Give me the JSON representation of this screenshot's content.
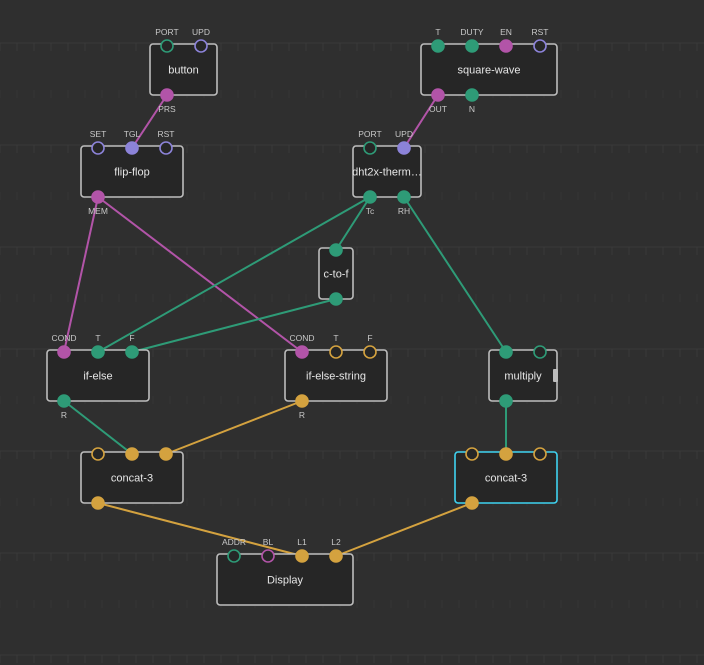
{
  "colors": {
    "background": "#2f2f2f",
    "grid": "#3a3a3a",
    "node_fill": "#262626",
    "node_border": "#bdbdbd",
    "selected_border": "#3fd3f1",
    "selected_label": "#3fd3f1",
    "pulse": "#8c83d9",
    "boolean": "#b254a8",
    "number": "#2e9b77",
    "string": "#d4a23f",
    "port": "#2e9b77"
  },
  "nodes": [
    {
      "id": "button",
      "label": "button",
      "selected": false,
      "inputs": [
        {
          "label": "PORT",
          "type": "port"
        },
        {
          "label": "UPD",
          "type": "pulse"
        }
      ],
      "outputs": [
        {
          "label": "PRS",
          "type": "boolean"
        }
      ]
    },
    {
      "id": "square-wave",
      "label": "square-wave",
      "selected": false,
      "inputs": [
        {
          "label": "T",
          "type": "number"
        },
        {
          "label": "DUTY",
          "type": "number"
        },
        {
          "label": "EN",
          "type": "boolean"
        },
        {
          "label": "RST",
          "type": "pulse"
        }
      ],
      "outputs": [
        {
          "label": "OUT",
          "type": "boolean"
        },
        {
          "label": "N",
          "type": "number"
        }
      ]
    },
    {
      "id": "flip-flop",
      "label": "flip-flop",
      "selected": false,
      "inputs": [
        {
          "label": "SET",
          "type": "pulse"
        },
        {
          "label": "TGL",
          "type": "pulse-filled"
        },
        {
          "label": "RST",
          "type": "pulse"
        }
      ],
      "outputs": [
        {
          "label": "MEM",
          "type": "boolean"
        }
      ]
    },
    {
      "id": "dht",
      "label": "dht2x-therm…",
      "selected": false,
      "inputs": [
        {
          "label": "PORT",
          "type": "port"
        },
        {
          "label": "UPD",
          "type": "pulse-filled"
        }
      ],
      "outputs": [
        {
          "label": "Tc",
          "type": "number"
        },
        {
          "label": "RH",
          "type": "number"
        }
      ]
    },
    {
      "id": "c-to-f",
      "label": "c-to-f",
      "selected": false,
      "inputs": [
        {
          "label": "",
          "type": "number"
        }
      ],
      "outputs": [
        {
          "label": "",
          "type": "number"
        }
      ]
    },
    {
      "id": "if-else",
      "label": "if-else",
      "selected": false,
      "inputs": [
        {
          "label": "COND",
          "type": "boolean"
        },
        {
          "label": "T",
          "type": "number"
        },
        {
          "label": "F",
          "type": "number"
        }
      ],
      "outputs": [
        {
          "label": "R",
          "type": "number"
        }
      ]
    },
    {
      "id": "if-else-string",
      "label": "if-else-string",
      "selected": false,
      "inputs": [
        {
          "label": "COND",
          "type": "boolean"
        },
        {
          "label": "T",
          "type": "string-open"
        },
        {
          "label": "F",
          "type": "string-open"
        }
      ],
      "outputs": [
        {
          "label": "R",
          "type": "string"
        }
      ]
    },
    {
      "id": "multiply",
      "label": "multiply",
      "selected": false,
      "inputs": [
        {
          "label": "",
          "type": "number"
        },
        {
          "label": "",
          "type": "number-open"
        }
      ],
      "outputs": [
        {
          "label": "",
          "type": "number"
        }
      ]
    },
    {
      "id": "concat-a",
      "label": "concat-3",
      "selected": false,
      "inputs": [
        {
          "label": "",
          "type": "string-open"
        },
        {
          "label": "",
          "type": "string"
        },
        {
          "label": "",
          "type": "string"
        }
      ],
      "outputs": [
        {
          "label": "",
          "type": "string"
        }
      ]
    },
    {
      "id": "concat-b",
      "label": "concat-3",
      "selected": true,
      "inputs": [
        {
          "label": "",
          "type": "string-open"
        },
        {
          "label": "",
          "type": "string"
        },
        {
          "label": "",
          "type": "string-open"
        }
      ],
      "outputs": [
        {
          "label": "",
          "type": "string"
        }
      ]
    },
    {
      "id": "display",
      "label": "Display",
      "selected": false,
      "inputs": [
        {
          "label": "ADDR",
          "type": "number-open"
        },
        {
          "label": "BL",
          "type": "boolean-open"
        },
        {
          "label": "L1",
          "type": "string"
        },
        {
          "label": "L2",
          "type": "string"
        }
      ],
      "outputs": []
    }
  ],
  "links": [
    {
      "from": "button.out.0",
      "to": "flip-flop.in.1",
      "type": "boolean"
    },
    {
      "from": "square-wave.out.0",
      "to": "dht.in.1",
      "type": "boolean"
    },
    {
      "from": "flip-flop.out.0",
      "to": "if-else.in.0",
      "type": "boolean"
    },
    {
      "from": "flip-flop.out.0",
      "to": "if-else-string.in.0",
      "type": "boolean"
    },
    {
      "from": "dht.out.0",
      "to": "c-to-f.in.0",
      "type": "number"
    },
    {
      "from": "dht.out.0",
      "to": "if-else.in.1",
      "type": "number"
    },
    {
      "from": "c-to-f.out.0",
      "to": "if-else.in.2",
      "type": "number"
    },
    {
      "from": "dht.out.1",
      "to": "multiply.in.0",
      "type": "number"
    },
    {
      "from": "multiply.out.0",
      "to": "concat-b.in.1",
      "type": "number"
    },
    {
      "from": "if-else.out.0",
      "to": "concat-a.in.1",
      "type": "number"
    },
    {
      "from": "if-else-string.out.0",
      "to": "concat-a.in.2",
      "type": "string"
    },
    {
      "from": "concat-a.out.0",
      "to": "display.in.2",
      "type": "string"
    },
    {
      "from": "concat-b.out.0",
      "to": "display.in.3",
      "type": "string"
    }
  ]
}
